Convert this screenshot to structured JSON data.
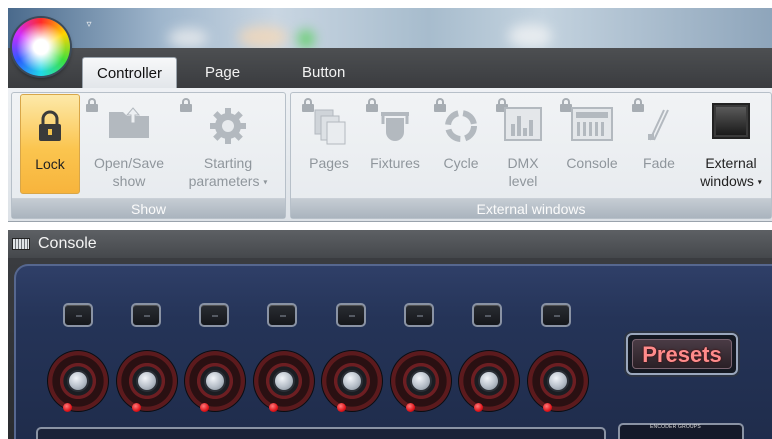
{
  "tabs": [
    {
      "label": "Controller",
      "active": true
    },
    {
      "label": "Page",
      "active": false
    },
    {
      "label": "Button",
      "active": false
    }
  ],
  "ribbon": {
    "groups": [
      {
        "label": "Show",
        "buttons": [
          {
            "label": "Lock",
            "icon": "padlock-icon",
            "active": true
          },
          {
            "label_line1": "Open/Save",
            "label_line2": "show",
            "icon": "folder-icon",
            "locked": true
          },
          {
            "label_line1": "Starting",
            "label_line2": "parameters",
            "icon": "gear-icon",
            "locked": true,
            "dropdown": true
          }
        ]
      },
      {
        "label": "External windows",
        "buttons": [
          {
            "label": "Pages",
            "icon": "pages-icon",
            "locked": true
          },
          {
            "label": "Fixtures",
            "icon": "fixture-icon",
            "locked": true
          },
          {
            "label": "Cycle",
            "icon": "cycle-icon",
            "locked": true
          },
          {
            "label_line1": "DMX",
            "label_line2": "level",
            "icon": "dmx-level-icon",
            "locked": true
          },
          {
            "label": "Console",
            "icon": "console-icon",
            "locked": true
          },
          {
            "label": "Fade",
            "icon": "fade-icon",
            "locked": true
          },
          {
            "label_line1": "External",
            "label_line2": "windows",
            "icon": "monitor-icon",
            "dropdown": true
          }
        ]
      }
    ]
  },
  "console_panel": {
    "title": "Console",
    "presets_label": "Presets",
    "encoder_groups_label": "ENCODER GROUPS"
  },
  "colors": {
    "accent_lock": "#fbc54f",
    "console_blue": "#253458",
    "led_red": "#e0151b"
  }
}
